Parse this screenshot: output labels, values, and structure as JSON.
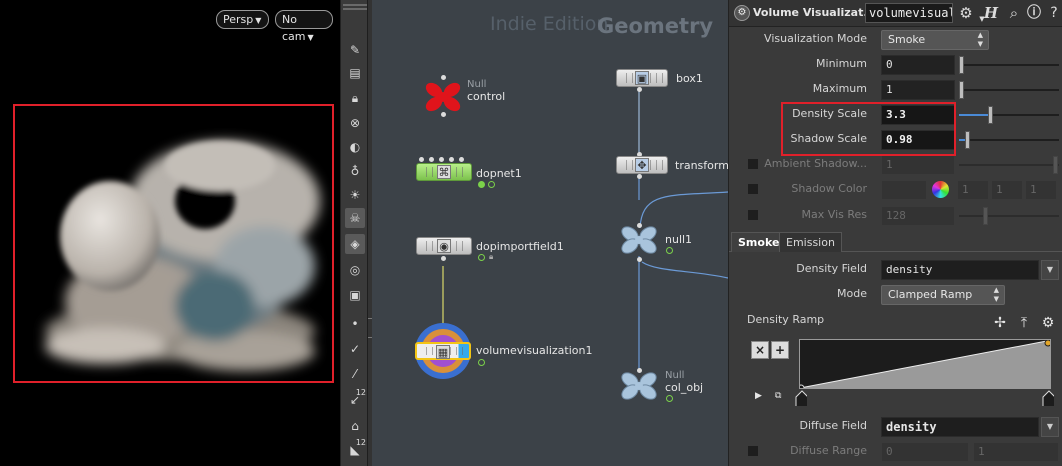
{
  "viewport": {
    "persp_label": "Persp",
    "cam_label": "No cam"
  },
  "network": {
    "edition_label": "Indie Edition",
    "context_label": "Geometry",
    "nodes": {
      "control": {
        "type": "Null",
        "name": "control"
      },
      "dopnet": {
        "name": "dopnet1"
      },
      "dopimport": {
        "name": "dopimportfield1"
      },
      "volviz": {
        "name": "volumevisualization1"
      },
      "box": {
        "name": "box1"
      },
      "transform": {
        "name": "transform..."
      },
      "null1": {
        "name": "null1"
      },
      "colobj": {
        "type": "Null",
        "name": "col_obj"
      }
    }
  },
  "params": {
    "node_type_label": "Volume Visualizat...",
    "node_name": "volumevisual",
    "viz_mode": {
      "label": "Visualization Mode",
      "value": "Smoke"
    },
    "minimum": {
      "label": "Minimum",
      "value": "0",
      "level": 0.0
    },
    "maximum": {
      "label": "Maximum",
      "value": "1",
      "level": 0.0
    },
    "density_scale": {
      "label": "Density Scale",
      "value": "3.3",
      "level": 0.3
    },
    "shadow_scale": {
      "label": "Shadow Scale",
      "value": "0.98",
      "level": 0.06
    },
    "ambient_shadow": {
      "label": "Ambient Shadow...",
      "value": "1"
    },
    "shadow_color": {
      "label": "Shadow Color",
      "r": "1",
      "g": "1",
      "b": "1"
    },
    "max_vis_res": {
      "label": "Max Vis Res",
      "value": "128"
    },
    "tabs": {
      "smoke": "Smoke",
      "emission": "Emission"
    },
    "density_field": {
      "label": "Density Field",
      "value": "density"
    },
    "mode": {
      "label": "Mode",
      "value": "Clamped Ramp"
    },
    "density_ramp": {
      "label": "Density Ramp"
    },
    "diffuse_field": {
      "label": "Diffuse Field",
      "value": "density"
    },
    "diffuse_range": {
      "label": "Diffuse Range",
      "min": "0",
      "max": "1"
    }
  }
}
